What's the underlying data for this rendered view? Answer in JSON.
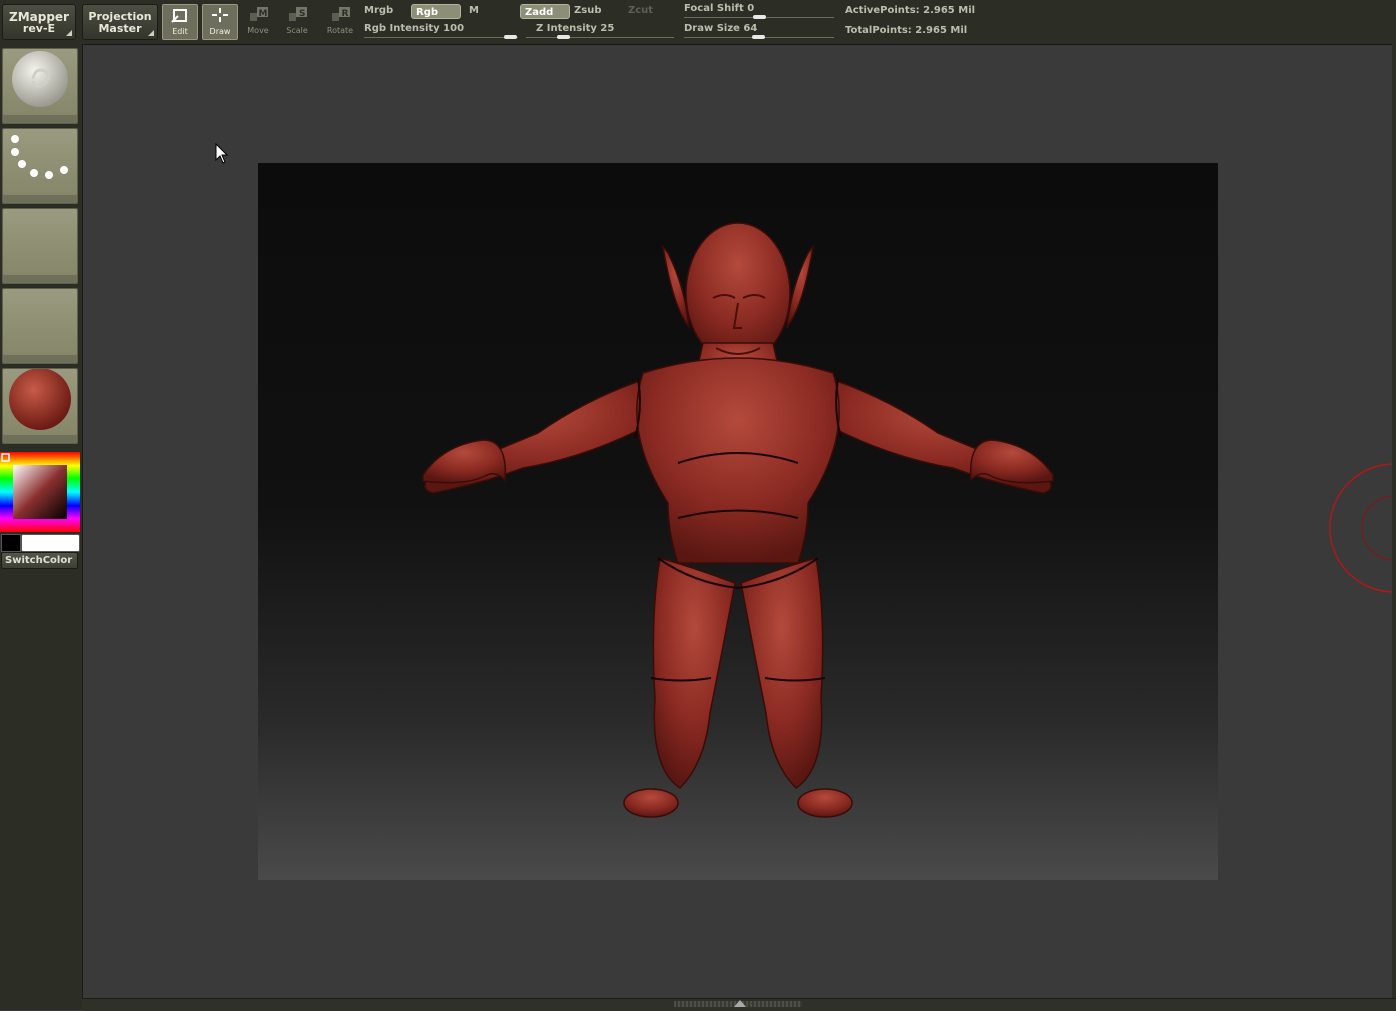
{
  "top_bar": {
    "zmapper": {
      "line1": "ZMapper",
      "line2": "rev-E"
    },
    "projection_master": {
      "line1": "Projection",
      "line2": "Master"
    },
    "tools": [
      {
        "name": "edit",
        "label": "Edit",
        "icon": "edit-icon",
        "active": true
      },
      {
        "name": "draw",
        "label": "Draw",
        "icon": "draw-icon",
        "active": true
      },
      {
        "name": "move",
        "label": "Move",
        "icon": "move-icon",
        "active": false
      },
      {
        "name": "scale",
        "label": "Scale",
        "icon": "scale-icon",
        "active": false
      },
      {
        "name": "rotate",
        "label": "Rotate",
        "icon": "rotate-icon",
        "active": false
      }
    ],
    "mrgb_label": "Mrgb",
    "rgb_label": "Rgb",
    "m_label": "M",
    "rgb_intensity": "Rgb Intensity 100",
    "zadd_label": "Zadd",
    "zsub_label": "Zsub",
    "zcut_label": "Zcut",
    "z_intensity": "Z Intensity 25",
    "focal_shift": "Focal Shift 0",
    "draw_size": "Draw Size 64",
    "active_points": "ActivePoints: 2.965 Mil",
    "total_points": "TotalPoints: 2.965 Mil"
  },
  "sidebar": {
    "slots": [
      "material-sphere-icon",
      "stroke-dots-icon",
      "empty-slot",
      "empty-slot",
      "red-material-sphere-icon"
    ],
    "switch_color_label": "SwitchColor"
  },
  "colors": {
    "panel": "#2c2e25",
    "canvas_bg": "#3a3a3a",
    "model_red": "#8a2a22",
    "slot_bg": "#9a9b7e"
  }
}
